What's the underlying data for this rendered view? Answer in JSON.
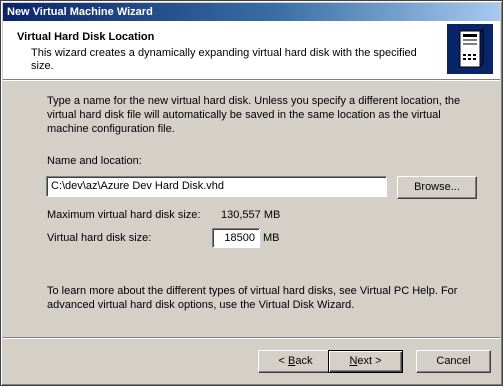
{
  "window": {
    "title": "New Virtual Machine Wizard"
  },
  "header": {
    "title": "Virtual Hard Disk Location",
    "subtitle": "This wizard creates a dynamically expanding virtual hard disk with the specified size.",
    "icon": "server-tower-icon"
  },
  "body": {
    "intro": "Type a name for the new virtual hard disk. Unless you specify a different location, the virtual hard disk file will automatically be saved in the same location as the virtual machine configuration file.",
    "name_label": "Name and location:",
    "path_value": "C:\\dev\\az\\Azure Dev Hard Disk.vhd",
    "browse_label": "Browse...",
    "max_size_label": "Maximum virtual hard disk size:",
    "max_size_value": "130,557 MB",
    "size_label": "Virtual hard disk size:",
    "size_value": "18500",
    "size_unit": "MB",
    "help_text": "To learn more about the different types of virtual hard disks, see Virtual PC Help. For advanced virtual hard disk options, use the Virtual Disk Wizard."
  },
  "footer": {
    "back_mnemonic": "B",
    "back_rest": "ack",
    "next_mnemonic": "N",
    "next_rest": "ext",
    "cancel_label": "Cancel"
  },
  "colors": {
    "titlebar_start": "#0a246a",
    "titlebar_end": "#a6caf0",
    "dialog_bg": "#d4d0c8",
    "header_bg": "#ffffff"
  }
}
